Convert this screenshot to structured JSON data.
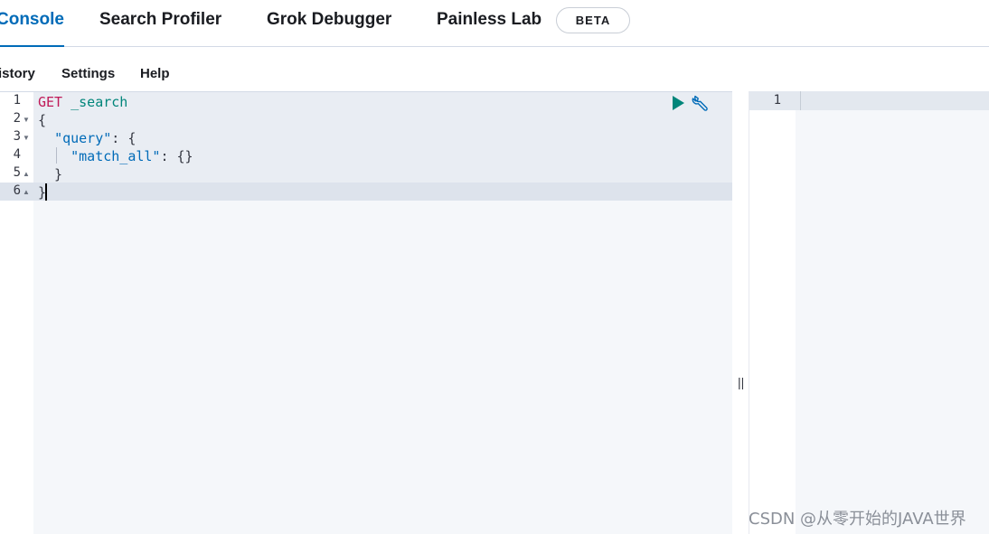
{
  "tabs": [
    {
      "label": "Console",
      "active": true
    },
    {
      "label": "Search Profiler",
      "active": false
    },
    {
      "label": "Grok Debugger",
      "active": false
    },
    {
      "label": "Painless Lab",
      "active": false
    }
  ],
  "beta_badge": "BETA",
  "menu": [
    "istory",
    "Settings",
    "Help"
  ],
  "editor": {
    "line_numbers": [
      "1",
      "2",
      "3",
      "4",
      "5",
      "6"
    ],
    "lines": {
      "l1_method": "GET",
      "l1_url": "_search",
      "l2": "{",
      "l3_key": "\"query\"",
      "l3_rest": ": {",
      "l4_key": "\"match_all\"",
      "l4_rest": ": {}",
      "l5": "  }",
      "l6": "}"
    },
    "icons": {
      "run": "play-icon",
      "settings": "wrench-icon"
    }
  },
  "divider_grip": "||",
  "output": {
    "line_numbers": [
      "1"
    ]
  },
  "watermark": "CSDN @从零开始的JAVA世界",
  "colors": {
    "accent": "#006bb8",
    "method": "#c01a58",
    "url": "#00857a",
    "key": "#006bb8",
    "play": "#00857a"
  }
}
